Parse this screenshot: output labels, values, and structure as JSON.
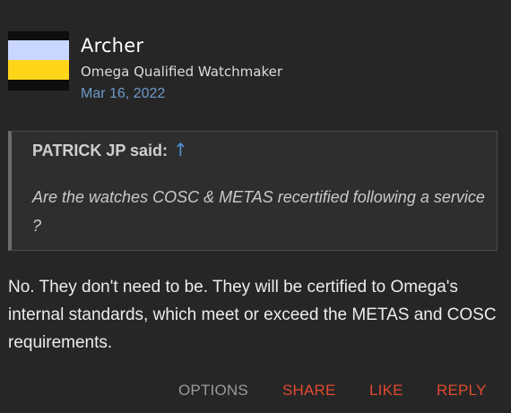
{
  "author": {
    "name": "Archer",
    "title": "Omega Qualified Watchmaker",
    "date": "Mar 16, 2022",
    "avatar_colors": [
      "#0d0d0d",
      "#c9d6ff",
      "#ffd51a"
    ]
  },
  "quote": {
    "author_said": "PATRICK JP said:",
    "jump_icon": "arrow-up-icon",
    "jump_glyph": "↑",
    "text": "Are the watches COSC & METAS recertified following a service ?"
  },
  "message": {
    "text": "No. They don't need to be. They will be certified to Omega's internal standards, which meet or exceed the METAS and COSC requirements."
  },
  "actions": {
    "options": "OPTIONS",
    "share": "SHARE",
    "like": "LIKE",
    "reply": "REPLY"
  },
  "colors": {
    "background": "#262626",
    "accent": "#e04a2f",
    "link": "#6d9ac9",
    "quote_link": "#4f93d8"
  }
}
